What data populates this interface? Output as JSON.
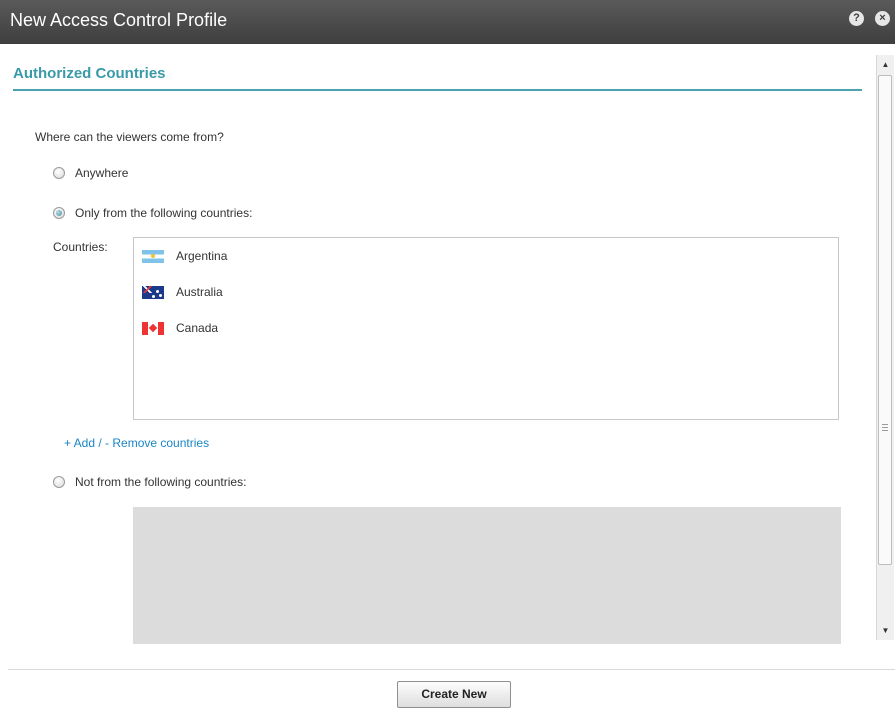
{
  "window": {
    "title": "New Access Control Profile",
    "help_icon": "?",
    "close_icon": "×"
  },
  "section": {
    "title": "Authorized Countries",
    "question": "Where can the viewers come from?"
  },
  "options": {
    "anywhere": {
      "label": "Anywhere",
      "checked": false
    },
    "only_from": {
      "label": "Only from the following countries:",
      "checked": true
    },
    "not_from": {
      "label": "Not from the following countries:",
      "checked": false
    }
  },
  "countries": {
    "label": "Countries:",
    "items": [
      {
        "name": "Argentina",
        "flag": "flag-argentina-icon"
      },
      {
        "name": "Australia",
        "flag": "flag-australia-icon"
      },
      {
        "name": "Canada",
        "flag": "flag-canada-icon"
      }
    ],
    "add_remove_link": "+ Add / - Remove countries"
  },
  "scrollbar": {
    "up": "▲",
    "down": "▼"
  },
  "footer": {
    "create_button": "Create New"
  },
  "colors": {
    "accent": "#3a9aa8",
    "link": "#1a86c6",
    "titlebar": "#4a4a4a"
  }
}
